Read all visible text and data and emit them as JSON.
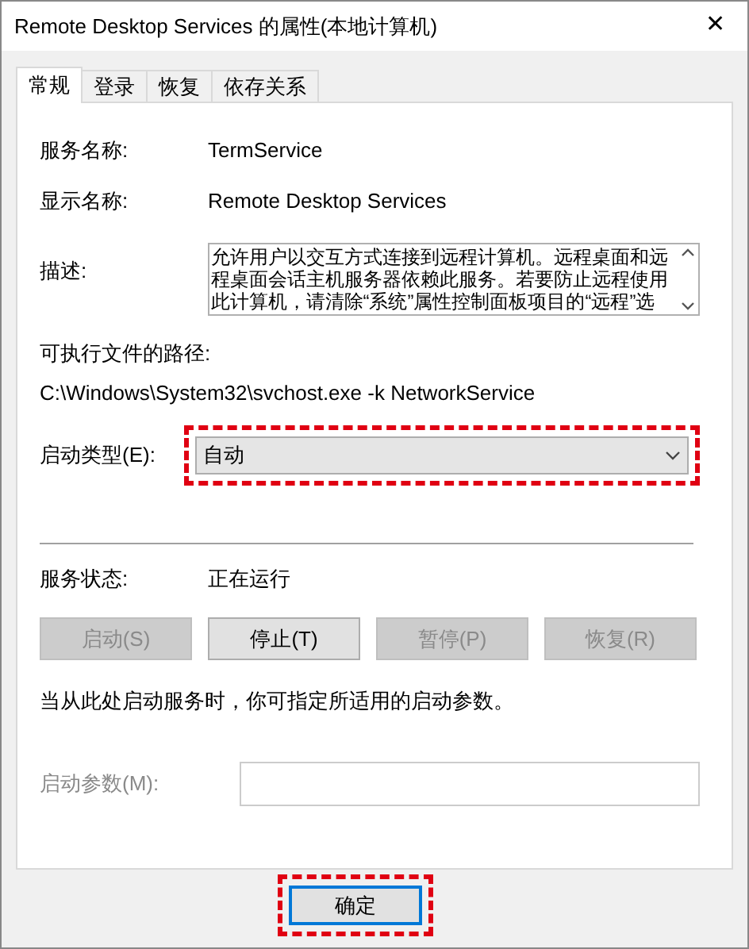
{
  "window": {
    "title": "Remote Desktop Services 的属性(本地计算机)",
    "close": "✕"
  },
  "tabs": [
    {
      "label": "常规",
      "selected": true
    },
    {
      "label": "登录",
      "selected": false
    },
    {
      "label": "恢复",
      "selected": false
    },
    {
      "label": "依存关系",
      "selected": false
    }
  ],
  "service_name": {
    "label": "服务名称:",
    "value": "TermService"
  },
  "display_name": {
    "label": "显示名称:",
    "value": "Remote Desktop Services"
  },
  "description": {
    "label": "描述:",
    "lines": [
      "允许用户以交互方式连接到远程计算机。远程桌面和远",
      "程桌面会话主机服务器依赖此服务。若要防止远程使用",
      "此计算机，请清除“系统”属性控制面板项目的“远程”选"
    ]
  },
  "executable_path": {
    "label": "可执行文件的路径:",
    "value": "C:\\Windows\\System32\\svchost.exe -k NetworkService"
  },
  "startup_type": {
    "label": "启动类型(E):",
    "value": "自动",
    "highlighted": true
  },
  "service_status": {
    "label": "服务状态:",
    "value": "正在运行"
  },
  "service_buttons": [
    {
      "label": "启动(S)",
      "disabled": true
    },
    {
      "label": "停止(T)",
      "disabled": false
    },
    {
      "label": "暂停(P)",
      "disabled": true
    },
    {
      "label": "恢复(R)",
      "disabled": true
    }
  ],
  "hint": "当从此处启动服务时，你可指定所适用的启动参数。",
  "start_parameters": {
    "label": "启动参数(M):",
    "disabled": true
  },
  "ok_button": {
    "label": "确定",
    "highlighted": true
  }
}
